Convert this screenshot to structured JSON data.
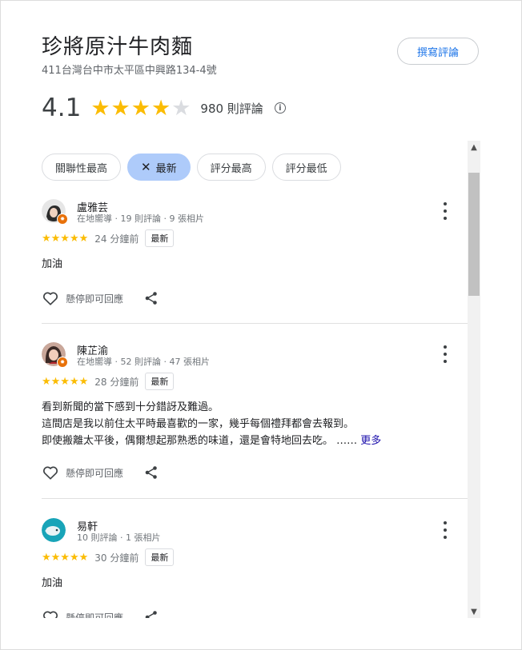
{
  "place": {
    "title": "珍將原汁牛肉麵",
    "address": "411台灣台中市太平區中興路134-4號",
    "write_review_label": "撰寫評論"
  },
  "rating": {
    "value": "4.1",
    "stars_filled": 4,
    "stars_total": 5,
    "review_count": "980 則評論"
  },
  "filters": {
    "chips": [
      {
        "label": "關聯性最高",
        "active": false
      },
      {
        "label": "最新",
        "active": true
      },
      {
        "label": "評分最高",
        "active": false
      },
      {
        "label": "評分最低",
        "active": false
      }
    ]
  },
  "reviews": [
    {
      "name": "盧雅芸",
      "meta": "在地嚮導 · 19 則評論 · 9 張相片",
      "stars": 5,
      "stars_text": "★★★★★",
      "time": "24 分鐘前",
      "badge": "最新",
      "text_lines": [
        "加油"
      ],
      "more_label": "",
      "like_label": "懸停即可回應"
    },
    {
      "name": "陳芷渝",
      "meta": "在地嚮導 · 52 則評論 · 47 張相片",
      "stars": 5,
      "stars_text": "★★★★★",
      "time": "28 分鐘前",
      "badge": "最新",
      "text_lines": [
        "看到新聞的當下感到十分錯訝及難過。",
        "這間店是我以前住太平時最喜歡的一家，幾乎每個禮拜都會去報到。",
        "即使搬離太平後，偶爾想起那熟悉的味道，還是會特地回去吃。 ……"
      ],
      "more_label": "更多",
      "like_label": "懸停即可回應"
    },
    {
      "name": "易軒",
      "meta": "10 則評論 · 1 張相片",
      "stars": 5,
      "stars_text": "★★★★★",
      "time": "30 分鐘前",
      "badge": "最新",
      "text_lines": [
        "加油"
      ],
      "more_label": "",
      "like_label": "懸停即可回應"
    }
  ],
  "colors": {
    "accent": "#1a73e8",
    "star": "#fbbc04",
    "active_chip": "#aecbfa",
    "badge": "#e8710a"
  }
}
